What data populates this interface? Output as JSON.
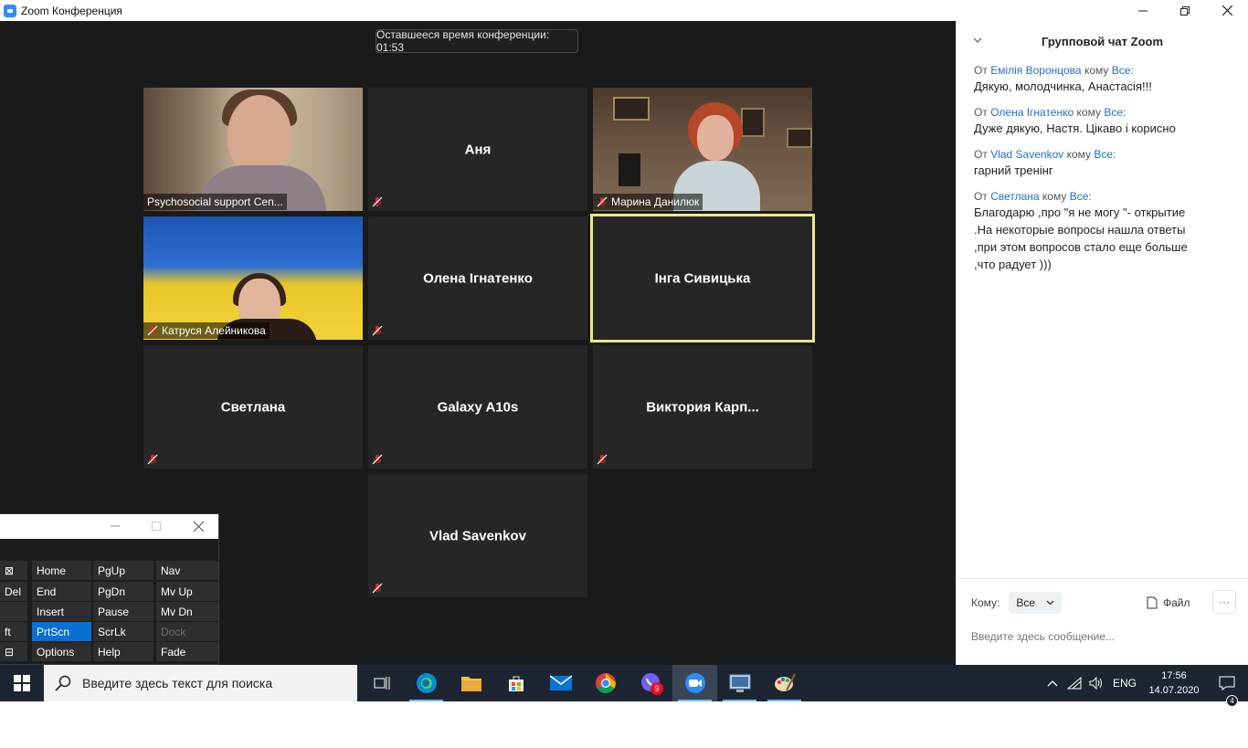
{
  "window": {
    "title": "Zoom Конференция"
  },
  "meeting": {
    "timer": "Оставшееся время конференции: 01:53",
    "tiles": [
      {
        "id": "t1",
        "label": "Psychosocial support Cen...",
        "video": true,
        "muted": false
      },
      {
        "id": "t2",
        "name": "Аня",
        "video": false,
        "muted": true
      },
      {
        "id": "t3",
        "label": "Марина Данилюк",
        "video": true,
        "muted": true
      },
      {
        "id": "t4",
        "label": "Катруся Алейникова",
        "video": true,
        "muted": true
      },
      {
        "id": "t5",
        "name": "Олена Ігнатенко",
        "video": false,
        "muted": true
      },
      {
        "id": "t6",
        "name": "Інга Сивицька",
        "video": false,
        "muted": false,
        "active_speaker": true
      },
      {
        "id": "t7",
        "name": "Светлана",
        "video": false,
        "muted": true
      },
      {
        "id": "t8",
        "name": "Galaxy A10s",
        "video": false,
        "muted": true
      },
      {
        "id": "t9",
        "name": "Виктория  Карп...",
        "video": false,
        "muted": true
      },
      {
        "id": "t10",
        "name": "Vlad Savenkov",
        "video": false,
        "muted": true
      }
    ]
  },
  "chat": {
    "title": "Групповой чат Zoom",
    "messages": [
      {
        "from_prefix": "От",
        "sender": "Емілія Воронцова",
        "to_prefix": "кому",
        "recipient": "Все:",
        "text": "Дякую, молодчинка, Анастасія!!!"
      },
      {
        "from_prefix": "От",
        "sender": "Олена Ігнатенко",
        "to_prefix": "кому",
        "recipient": "Все:",
        "text": "Дуже дякую, Настя. Цікаво і корисно"
      },
      {
        "from_prefix": "От",
        "sender": "Vlad Savenkov",
        "to_prefix": "кому",
        "recipient": "Все:",
        "text": "гарний тренінг"
      },
      {
        "from_prefix": "От",
        "sender": "Светлана",
        "to_prefix": "кому",
        "recipient": "Все:",
        "text": "Благодарю ,про \"я не могу \"- открытие\n.На некоторые вопросы нашла ответы\n,при этом вопросов стало еще больше\n,что радует )))"
      }
    ],
    "compose": {
      "to_label": "Кому:",
      "to_value": "Все",
      "file_label": "Файл",
      "more_label": "···",
      "placeholder": "Введите здесь сообщение..."
    }
  },
  "keyboard": {
    "rows": [
      [
        "⊠",
        "Home",
        "PgUp",
        "Nav"
      ],
      [
        "Del",
        "End",
        "PgDn",
        "Mv Up"
      ],
      [
        "",
        "Insert",
        "Pause",
        "Mv Dn"
      ],
      [
        "ft",
        "PrtScn",
        "ScrLk",
        "Dock"
      ],
      [
        "⊟",
        "Options",
        "Help",
        "Fade"
      ]
    ],
    "highlighted": "PrtScn",
    "disabled": "Dock"
  },
  "taskbar": {
    "search_placeholder": "Введите здесь текст для поиска",
    "apps": [
      "task-view",
      "edge",
      "file-explorer",
      "store",
      "mail",
      "chrome",
      "viber",
      "zoom",
      "remote-desktop",
      "paint"
    ],
    "viber_badge": "9",
    "language": "ENG",
    "time": "17:56",
    "date": "14.07.2020",
    "notifications": "4"
  },
  "colors": {
    "meeting_bg": "#1a1a1a",
    "tile_bg": "#262626",
    "active_speaker": "#e8e88a",
    "link_blue": "#1f6fd0",
    "keyboard_highlight": "#0a6fd6",
    "taskbar_bg": "#1c2531"
  }
}
